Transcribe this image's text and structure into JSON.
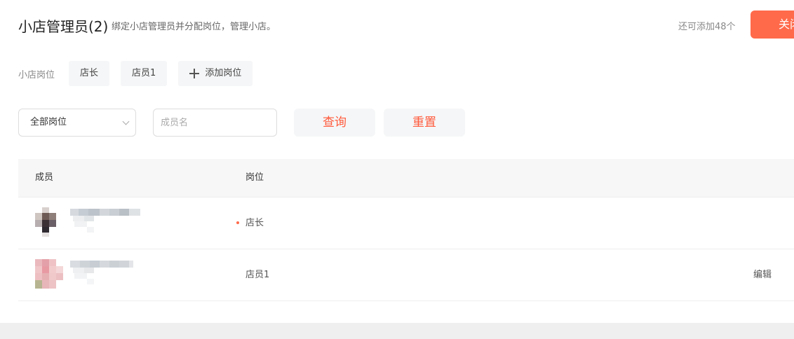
{
  "header": {
    "title": "小店管理员(2)",
    "subtitle": "绑定小店管理员并分配岗位，管理小店。",
    "quota": "还可添加48个",
    "close_label": "关闭"
  },
  "posts": {
    "label": "小店岗位",
    "items": [
      "店长",
      "店员1"
    ],
    "add_label": "添加岗位"
  },
  "filters": {
    "select_value": "全部岗位",
    "name_placeholder": "成员名",
    "query_label": "查询",
    "reset_label": "重置"
  },
  "table": {
    "columns": [
      "成员",
      "岗位"
    ],
    "rows": [
      {
        "post": "店长",
        "action": ""
      },
      {
        "post": "店员1",
        "action": "编辑"
      }
    ]
  },
  "colors": {
    "accent": "#ff6a4a",
    "accent_text": "#ff5a3c",
    "chip_bg": "#f5f6f7"
  }
}
